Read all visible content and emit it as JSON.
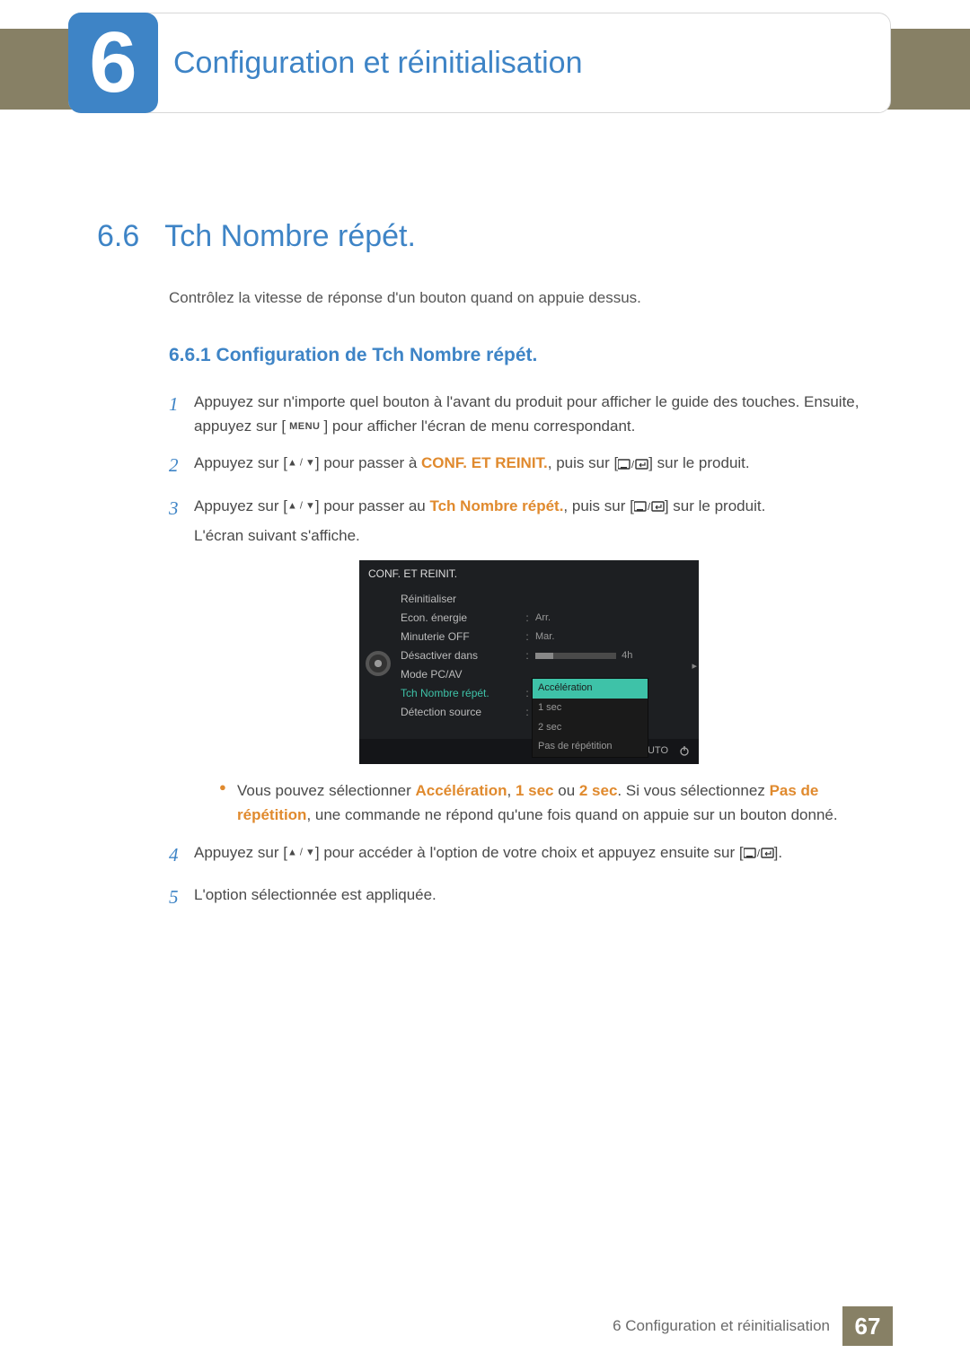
{
  "chapter": {
    "number": "6",
    "title": "Configuration et réinitialisation"
  },
  "section": {
    "number": "6.6",
    "title": "Tch Nombre répét."
  },
  "intro": "Contrôlez la vitesse de réponse d'un bouton quand on appuie dessus.",
  "subsection": "6.6.1   Configuration de Tch Nombre répét.",
  "steps": {
    "s1": {
      "num": "1",
      "a": "Appuyez sur n'importe quel bouton à l'avant du produit pour afficher le guide des touches. Ensuite, appuyez sur [",
      "menu": "MENU",
      "b": "] pour afficher l'écran de menu correspondant."
    },
    "s2": {
      "num": "2",
      "a": "Appuyez sur [",
      "b": "] pour passer à ",
      "bold": "CONF. ET REINIT.",
      "c": ", puis sur [",
      "d": "] sur le produit."
    },
    "s3": {
      "num": "3",
      "a": "Appuyez sur [",
      "b": "] pour passer au ",
      "bold": "Tch Nombre répét.",
      "c": ", puis sur [",
      "d": "] sur le produit.",
      "e": "L'écran suivant s'affiche."
    },
    "note": {
      "a": "Vous pouvez sélectionner ",
      "b1": "Accélération",
      "comma1": ", ",
      "b2": "1 sec",
      "or": " ou ",
      "b3": "2 sec",
      "c": ". Si vous sélectionnez ",
      "b4": "Pas de répétition",
      "d": ", une commande ne répond qu'une fois quand on appuie sur un bouton donné."
    },
    "s4": {
      "num": "4",
      "a": "Appuyez sur [",
      "b": "] pour accéder à l'option de votre choix et appuyez ensuite sur [",
      "c": "]."
    },
    "s5": {
      "num": "5",
      "a": "L'option sélectionnée est appliquée."
    }
  },
  "osd": {
    "title": "CONF. ET REINIT.",
    "items": {
      "reinit": "Réinitialiser",
      "econ": "Econ. énergie",
      "minuterie": "Minuterie OFF",
      "desact": "Désactiver dans",
      "mode": "Mode PC/AV",
      "tch": "Tch Nombre répét.",
      "detect": "Détection source"
    },
    "vals": {
      "arr": "Arr.",
      "mar": "Mar.",
      "h4": "4h"
    },
    "dropdown": {
      "opt1": "Accélération",
      "opt2": "1 sec",
      "opt3": "2 sec",
      "opt4": "Pas de répétition"
    },
    "bottom": {
      "auto": "AUTO"
    }
  },
  "footer": {
    "label": "6 Configuration et réinitialisation",
    "page": "67"
  }
}
